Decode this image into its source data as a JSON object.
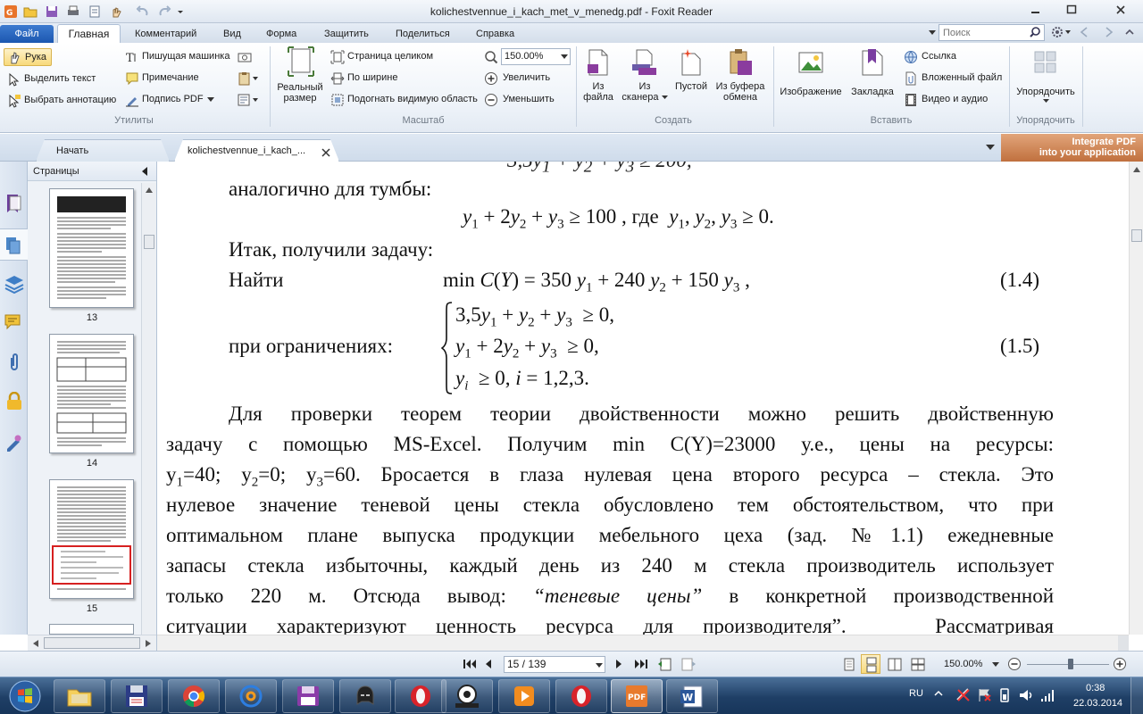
{
  "window": {
    "title": "kolichestvennue_i_kach_met_v_menedg.pdf - Foxit Reader"
  },
  "ribbon_tabs": [
    {
      "label": "Файл"
    },
    {
      "label": "Главная"
    },
    {
      "label": "Комментарий"
    },
    {
      "label": "Вид"
    },
    {
      "label": "Форма"
    },
    {
      "label": "Защитить"
    },
    {
      "label": "Поделиться"
    },
    {
      "label": "Справка"
    }
  ],
  "search": {
    "placeholder": "Поиск"
  },
  "ribbon": {
    "utilities": {
      "label": "Утилиты",
      "hand": "Рука",
      "select_text": "Выделить текст",
      "select_annotation": "Выбрать аннотацию",
      "typewriter": "Пишущая машинка",
      "note": "Примечание",
      "pdf_sign": "Подпись PDF"
    },
    "zoom": {
      "label": "Масштаб",
      "actual_size_1": "Реальный",
      "actual_size_2": "размер",
      "fit_page": "Страница целиком",
      "fit_width": "По ширине",
      "fit_visible": "Подогнать видимую область",
      "zoom_value": "150.00%",
      "zoom_in": "Увеличить",
      "zoom_out": "Уменьшить"
    },
    "create": {
      "label": "Создать",
      "from_file_1": "Из",
      "from_file_2": "файла",
      "from_scanner_1": "Из",
      "from_scanner_2": "сканера",
      "blank": "Пустой",
      "from_clipboard_1": "Из буфера",
      "from_clipboard_2": "обмена"
    },
    "insert": {
      "label": "Вставить",
      "image": "Изображение",
      "bookmark": "Закладка",
      "link": "Ссылка",
      "attachment": "Вложенный файл",
      "video_audio": "Видео и аудио"
    },
    "arrange": {
      "label": "Упорядочить",
      "button": "Упорядочить"
    }
  },
  "doc_tabs": [
    {
      "label": "Начать"
    },
    {
      "label": "kolichestvennue_i_kach_..."
    }
  ],
  "banner": {
    "line1": "Integrate PDF",
    "line2": "into your application"
  },
  "pages_panel": {
    "title": "Страницы",
    "thumbnails": [
      {
        "num": "13"
      },
      {
        "num": "14"
      },
      {
        "num": "15"
      }
    ]
  },
  "document": {
    "line_analog": "аналогично для тумбы:",
    "line_itak": "Итак, получили задачу:",
    "line_find": "Найти",
    "eq_14_num": "(1.4)",
    "line_constraints": "при ограничениях:",
    "eq_15_num": "(1.5)",
    "para": [
      "Для проверки теорем теории двойственности можно решить двойственную",
      "задачу с помощью MS-Excel. Получим min C(Y)=23000 у.е., цены на ресурсы:",
      "нулевое значение теневой цены стекла обусловлено тем обстоятельством, что при",
      "оптимальном плане выпуска продукции мебельного цеха (зад. №1.1) ежедневные",
      "запасы стекла избыточны, каждый день из 240 м стекла производитель использует"
    ],
    "line_prices": {
      "y1": "y",
      "s1": "1",
      "v1": "=40; ",
      "y2": "y",
      "s2": "2",
      "v2": "=0; ",
      "y3": "y",
      "s3": "3",
      "v3": "=60. Бросается в глаза нулевая цена второго ресурса – стекла. Это"
    },
    "line_220": {
      "a": "только 220 м. Отсюда вывод: ",
      "b": "“теневые цены”",
      "c": " в конкретной производственной"
    },
    "line_last": {
      "a": "ситуации характеризуют ценность ресурса для производителя”.",
      "b": "Рассматривая"
    }
  },
  "statusbar": {
    "page": "15 / 139",
    "zoom": "150.00%"
  },
  "taskbar": {
    "lang": "RU",
    "time": "0:38",
    "date": "22.03.2014"
  }
}
